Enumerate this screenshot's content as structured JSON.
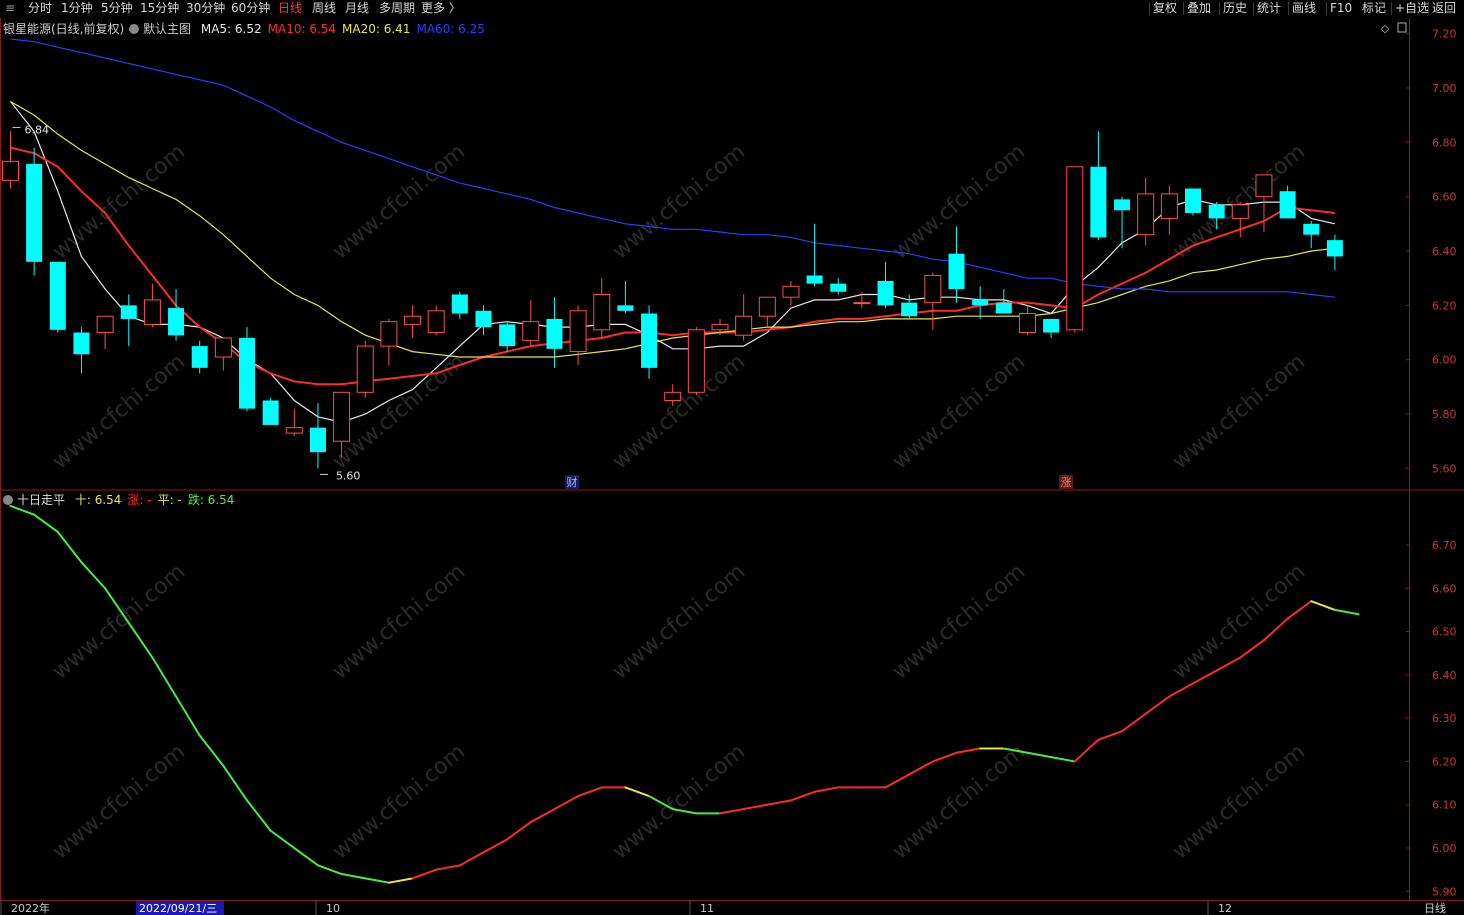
{
  "toolbar": {
    "period_tabs": [
      {
        "label": "分时",
        "active": false
      },
      {
        "label": "1分钟",
        "active": false
      },
      {
        "label": "5分钟",
        "active": false
      },
      {
        "label": "15分钟",
        "active": false
      },
      {
        "label": "30分钟",
        "active": false
      },
      {
        "label": "60分钟",
        "active": false
      },
      {
        "label": "日线",
        "active": true
      },
      {
        "label": "周线",
        "active": false
      },
      {
        "label": "月线",
        "active": false
      },
      {
        "label": "多周期",
        "active": false
      },
      {
        "label": "更多 〉",
        "active": false
      }
    ],
    "right_buttons": [
      "复权",
      "叠加",
      "历史",
      "统计",
      "画线",
      "F10",
      "+自选",
      "返回"
    ],
    "mark_label": "标记"
  },
  "main_chart": {
    "stock_label": "银星能源(日线,前复权)",
    "template_label": "默认主图",
    "ma_items": [
      {
        "text": "MA5: 6.52",
        "color": "#e8e8e8"
      },
      {
        "text": "MA10: 6.54",
        "color": "#ff2a2a"
      },
      {
        "text": "MA20: 6.41",
        "color": "#e6e64a"
      },
      {
        "text": "MA60: 6.25",
        "color": "#2a3cff"
      }
    ],
    "high_marker": "6.84",
    "low_marker": "5.60",
    "event_markers": [
      {
        "text": "财",
        "color": "#9fb6ff"
      },
      {
        "text": "涨",
        "color": "#ff7777"
      }
    ]
  },
  "sub_chart": {
    "title": "十日走平",
    "items": [
      {
        "text": "十: 6.54",
        "color": "#e6e64a"
      },
      {
        "text": "涨: -",
        "color": "#ff2a2a"
      },
      {
        "text": "平: -",
        "color": "#e6e64a"
      },
      {
        "text": "跌: 6.54",
        "color": "#44ee44"
      }
    ]
  },
  "x_axis": {
    "labels": [
      "2022年",
      "10",
      "11",
      "12"
    ],
    "cursor_date": "2022/09/21/三",
    "period_label": "日线"
  },
  "chart_data": [
    {
      "type": "candlestick",
      "ylim": [
        5.55,
        7.25
      ],
      "y_ticks": [
        5.6,
        5.8,
        6.0,
        6.2,
        6.4,
        6.6,
        6.8,
        7.0,
        7.2
      ],
      "candles": [
        {
          "o": 6.66,
          "h": 6.84,
          "l": 6.63,
          "c": 6.73
        },
        {
          "o": 6.72,
          "h": 6.78,
          "l": 6.31,
          "c": 6.36
        },
        {
          "o": 6.36,
          "h": 6.36,
          "l": 6.1,
          "c": 6.11
        },
        {
          "o": 6.1,
          "h": 6.12,
          "l": 5.95,
          "c": 6.02
        },
        {
          "o": 6.1,
          "h": 6.16,
          "l": 6.04,
          "c": 6.16
        },
        {
          "o": 6.2,
          "h": 6.24,
          "l": 6.05,
          "c": 6.15
        },
        {
          "o": 6.13,
          "h": 6.28,
          "l": 6.12,
          "c": 6.22
        },
        {
          "o": 6.19,
          "h": 6.26,
          "l": 6.07,
          "c": 6.09
        },
        {
          "o": 6.05,
          "h": 6.07,
          "l": 5.95,
          "c": 5.97
        },
        {
          "o": 6.01,
          "h": 6.08,
          "l": 5.96,
          "c": 6.08
        },
        {
          "o": 6.08,
          "h": 6.12,
          "l": 5.81,
          "c": 5.82
        },
        {
          "o": 5.85,
          "h": 5.86,
          "l": 5.76,
          "c": 5.76
        },
        {
          "o": 5.73,
          "h": 5.82,
          "l": 5.72,
          "c": 5.75
        },
        {
          "o": 5.75,
          "h": 5.84,
          "l": 5.6,
          "c": 5.66
        },
        {
          "o": 5.7,
          "h": 5.88,
          "l": 5.64,
          "c": 5.88
        },
        {
          "o": 5.88,
          "h": 6.07,
          "l": 5.86,
          "c": 6.05
        },
        {
          "o": 6.05,
          "h": 6.15,
          "l": 5.98,
          "c": 6.14
        },
        {
          "o": 6.13,
          "h": 6.2,
          "l": 6.08,
          "c": 6.16
        },
        {
          "o": 6.1,
          "h": 6.2,
          "l": 6.09,
          "c": 6.18
        },
        {
          "o": 6.24,
          "h": 6.25,
          "l": 6.15,
          "c": 6.17
        },
        {
          "o": 6.18,
          "h": 6.2,
          "l": 6.09,
          "c": 6.12
        },
        {
          "o": 6.13,
          "h": 6.14,
          "l": 6.03,
          "c": 6.05
        },
        {
          "o": 6.07,
          "h": 6.22,
          "l": 6.05,
          "c": 6.14
        },
        {
          "o": 6.15,
          "h": 6.23,
          "l": 5.97,
          "c": 6.04
        },
        {
          "o": 6.03,
          "h": 6.2,
          "l": 5.98,
          "c": 6.18
        },
        {
          "o": 6.11,
          "h": 6.3,
          "l": 6.08,
          "c": 6.24
        },
        {
          "o": 6.2,
          "h": 6.29,
          "l": 6.17,
          "c": 6.18
        },
        {
          "o": 6.17,
          "h": 6.2,
          "l": 5.93,
          "c": 5.97
        },
        {
          "o": 5.85,
          "h": 5.91,
          "l": 5.83,
          "c": 5.88
        },
        {
          "o": 5.88,
          "h": 6.12,
          "l": 5.87,
          "c": 6.11
        },
        {
          "o": 6.11,
          "h": 6.15,
          "l": 6.09,
          "c": 6.13
        },
        {
          "o": 6.09,
          "h": 6.24,
          "l": 6.07,
          "c": 6.16
        },
        {
          "o": 6.16,
          "h": 6.23,
          "l": 6.12,
          "c": 6.23
        },
        {
          "o": 6.23,
          "h": 6.29,
          "l": 6.2,
          "c": 6.27
        },
        {
          "o": 6.31,
          "h": 6.5,
          "l": 6.27,
          "c": 6.28
        },
        {
          "o": 6.28,
          "h": 6.3,
          "l": 6.24,
          "c": 6.25
        },
        {
          "o": 6.21,
          "h": 6.25,
          "l": 6.19,
          "c": 6.21
        },
        {
          "o": 6.29,
          "h": 6.36,
          "l": 6.19,
          "c": 6.2
        },
        {
          "o": 6.21,
          "h": 6.24,
          "l": 6.15,
          "c": 6.16
        },
        {
          "o": 6.21,
          "h": 6.32,
          "l": 6.11,
          "c": 6.31
        },
        {
          "o": 6.39,
          "h": 6.49,
          "l": 6.21,
          "c": 6.26
        },
        {
          "o": 6.22,
          "h": 6.27,
          "l": 6.15,
          "c": 6.2
        },
        {
          "o": 6.21,
          "h": 6.26,
          "l": 6.17,
          "c": 6.17
        },
        {
          "o": 6.1,
          "h": 6.2,
          "l": 6.09,
          "c": 6.17
        },
        {
          "o": 6.15,
          "h": 6.15,
          "l": 6.08,
          "c": 6.1
        },
        {
          "o": 6.11,
          "h": 6.71,
          "l": 6.1,
          "c": 6.71
        },
        {
          "o": 6.71,
          "h": 6.84,
          "l": 6.44,
          "c": 6.45
        },
        {
          "o": 6.59,
          "h": 6.6,
          "l": 6.41,
          "c": 6.55
        },
        {
          "o": 6.46,
          "h": 6.67,
          "l": 6.42,
          "c": 6.61
        },
        {
          "o": 6.52,
          "h": 6.64,
          "l": 6.46,
          "c": 6.61
        },
        {
          "o": 6.63,
          "h": 6.63,
          "l": 6.53,
          "c": 6.54
        },
        {
          "o": 6.57,
          "h": 6.58,
          "l": 6.48,
          "c": 6.52
        },
        {
          "o": 6.52,
          "h": 6.58,
          "l": 6.45,
          "c": 6.57
        },
        {
          "o": 6.6,
          "h": 6.68,
          "l": 6.47,
          "c": 6.68
        },
        {
          "o": 6.62,
          "h": 6.64,
          "l": 6.52,
          "c": 6.52
        },
        {
          "o": 6.5,
          "h": 6.51,
          "l": 6.41,
          "c": 6.46
        },
        {
          "o": 6.44,
          "h": 6.46,
          "l": 6.33,
          "c": 6.38
        }
      ],
      "ma_series": [
        {
          "name": "MA5",
          "color": "#e8e8e8",
          "values": [
            6.95,
            6.84,
            6.62,
            6.38,
            6.26,
            6.16,
            6.13,
            6.13,
            6.12,
            6.08,
            6.0,
            5.95,
            5.85,
            5.79,
            5.77,
            5.8,
            5.85,
            5.89,
            5.97,
            6.05,
            6.13,
            6.14,
            6.13,
            6.12,
            6.12,
            6.13,
            6.13,
            6.09,
            6.04,
            6.04,
            6.05,
            6.05,
            6.1,
            6.19,
            6.22,
            6.22,
            6.24,
            6.24,
            6.22,
            6.23,
            6.23,
            6.22,
            6.22,
            6.2,
            6.17,
            6.27,
            6.34,
            6.43,
            6.48,
            6.56,
            6.59,
            6.57,
            6.57,
            6.58,
            6.58,
            6.52,
            6.5
          ]
        },
        {
          "name": "MA10",
          "color": "#ff2a2a",
          "values": [
            6.78,
            6.76,
            6.71,
            6.62,
            6.54,
            6.42,
            6.31,
            6.2,
            6.12,
            6.06,
            5.99,
            5.95,
            5.92,
            5.91,
            5.91,
            5.92,
            5.93,
            5.94,
            5.95,
            5.98,
            6.01,
            6.03,
            6.05,
            6.06,
            6.07,
            6.08,
            6.1,
            6.1,
            6.09,
            6.1,
            6.1,
            6.1,
            6.11,
            6.12,
            6.14,
            6.15,
            6.15,
            6.16,
            6.17,
            6.18,
            6.18,
            6.2,
            6.21,
            6.21,
            6.2,
            6.19,
            6.24,
            6.28,
            6.32,
            6.37,
            6.42,
            6.45,
            6.48,
            6.51,
            6.56,
            6.55,
            6.54
          ]
        },
        {
          "name": "MA20",
          "color": "#e6e64a",
          "values": [
            6.95,
            6.9,
            6.83,
            6.77,
            6.72,
            6.67,
            6.63,
            6.59,
            6.53,
            6.46,
            6.38,
            6.3,
            6.24,
            6.2,
            6.14,
            6.09,
            6.06,
            6.03,
            6.02,
            6.01,
            6.01,
            6.01,
            6.01,
            6.01,
            6.02,
            6.03,
            6.04,
            6.06,
            6.08,
            6.09,
            6.1,
            6.11,
            6.12,
            6.12,
            6.13,
            6.14,
            6.14,
            6.15,
            6.15,
            6.15,
            6.16,
            6.16,
            6.16,
            6.16,
            6.17,
            6.19,
            6.21,
            6.24,
            6.27,
            6.29,
            6.32,
            6.33,
            6.35,
            6.37,
            6.38,
            6.4,
            6.41
          ]
        },
        {
          "name": "MA60",
          "color": "#2a3cff",
          "values": [
            7.18,
            7.17,
            7.15,
            7.13,
            7.11,
            7.09,
            7.07,
            7.05,
            7.03,
            7.01,
            6.97,
            6.93,
            6.88,
            6.84,
            6.8,
            6.77,
            6.74,
            6.71,
            6.68,
            6.65,
            6.63,
            6.61,
            6.59,
            6.56,
            6.54,
            6.52,
            6.5,
            6.49,
            6.48,
            6.48,
            6.47,
            6.46,
            6.46,
            6.45,
            6.43,
            6.42,
            6.41,
            6.4,
            6.39,
            6.37,
            6.36,
            6.34,
            6.32,
            6.3,
            6.3,
            6.28,
            6.27,
            6.26,
            6.26,
            6.25,
            6.25,
            6.25,
            6.25,
            6.25,
            6.25,
            6.24,
            6.23
          ]
        }
      ]
    },
    {
      "type": "line",
      "title": "十日走平",
      "ylim": [
        5.88,
        6.82
      ],
      "y_ticks": [
        5.9,
        6.0,
        6.1,
        6.2,
        6.3,
        6.4,
        6.5,
        6.6,
        6.7
      ],
      "series": [
        {
          "name": "十",
          "values": [
            6.79,
            6.77,
            6.73,
            6.66,
            6.6,
            6.52,
            6.44,
            6.35,
            6.26,
            6.19,
            6.11,
            6.04,
            6.0,
            5.96,
            5.94,
            5.93,
            5.92,
            5.93,
            5.95,
            5.96,
            5.99,
            6.02,
            6.06,
            6.09,
            6.12,
            6.14,
            6.14,
            6.12,
            6.09,
            6.08,
            6.08,
            6.09,
            6.1,
            6.11,
            6.13,
            6.14,
            6.14,
            6.14,
            6.17,
            6.2,
            6.22,
            6.23,
            6.23,
            6.22,
            6.21,
            6.2,
            6.25,
            6.27,
            6.31,
            6.35,
            6.38,
            6.41,
            6.44,
            6.48,
            6.53,
            6.57,
            6.55,
            6.54
          ]
        },
        {
          "name": "涨",
          "color": "#ff2a2a"
        },
        {
          "name": "平",
          "color": "#e6e64a"
        },
        {
          "name": "跌",
          "color": "#44ee44"
        }
      ],
      "segment_states": [
        "down",
        "down",
        "down",
        "down",
        "down",
        "down",
        "down",
        "down",
        "down",
        "down",
        "down",
        "down",
        "down",
        "down",
        "down",
        "down",
        "flat",
        "up",
        "up",
        "up",
        "up",
        "up",
        "up",
        "up",
        "up",
        "up",
        "flat",
        "down",
        "down",
        "down",
        "up",
        "up",
        "up",
        "up",
        "up",
        "up",
        "up",
        "up",
        "up",
        "up",
        "up",
        "flat",
        "down",
        "down",
        "down",
        "up",
        "up",
        "up",
        "up",
        "up",
        "up",
        "up",
        "up",
        "up",
        "up",
        "flat",
        "down"
      ]
    }
  ]
}
